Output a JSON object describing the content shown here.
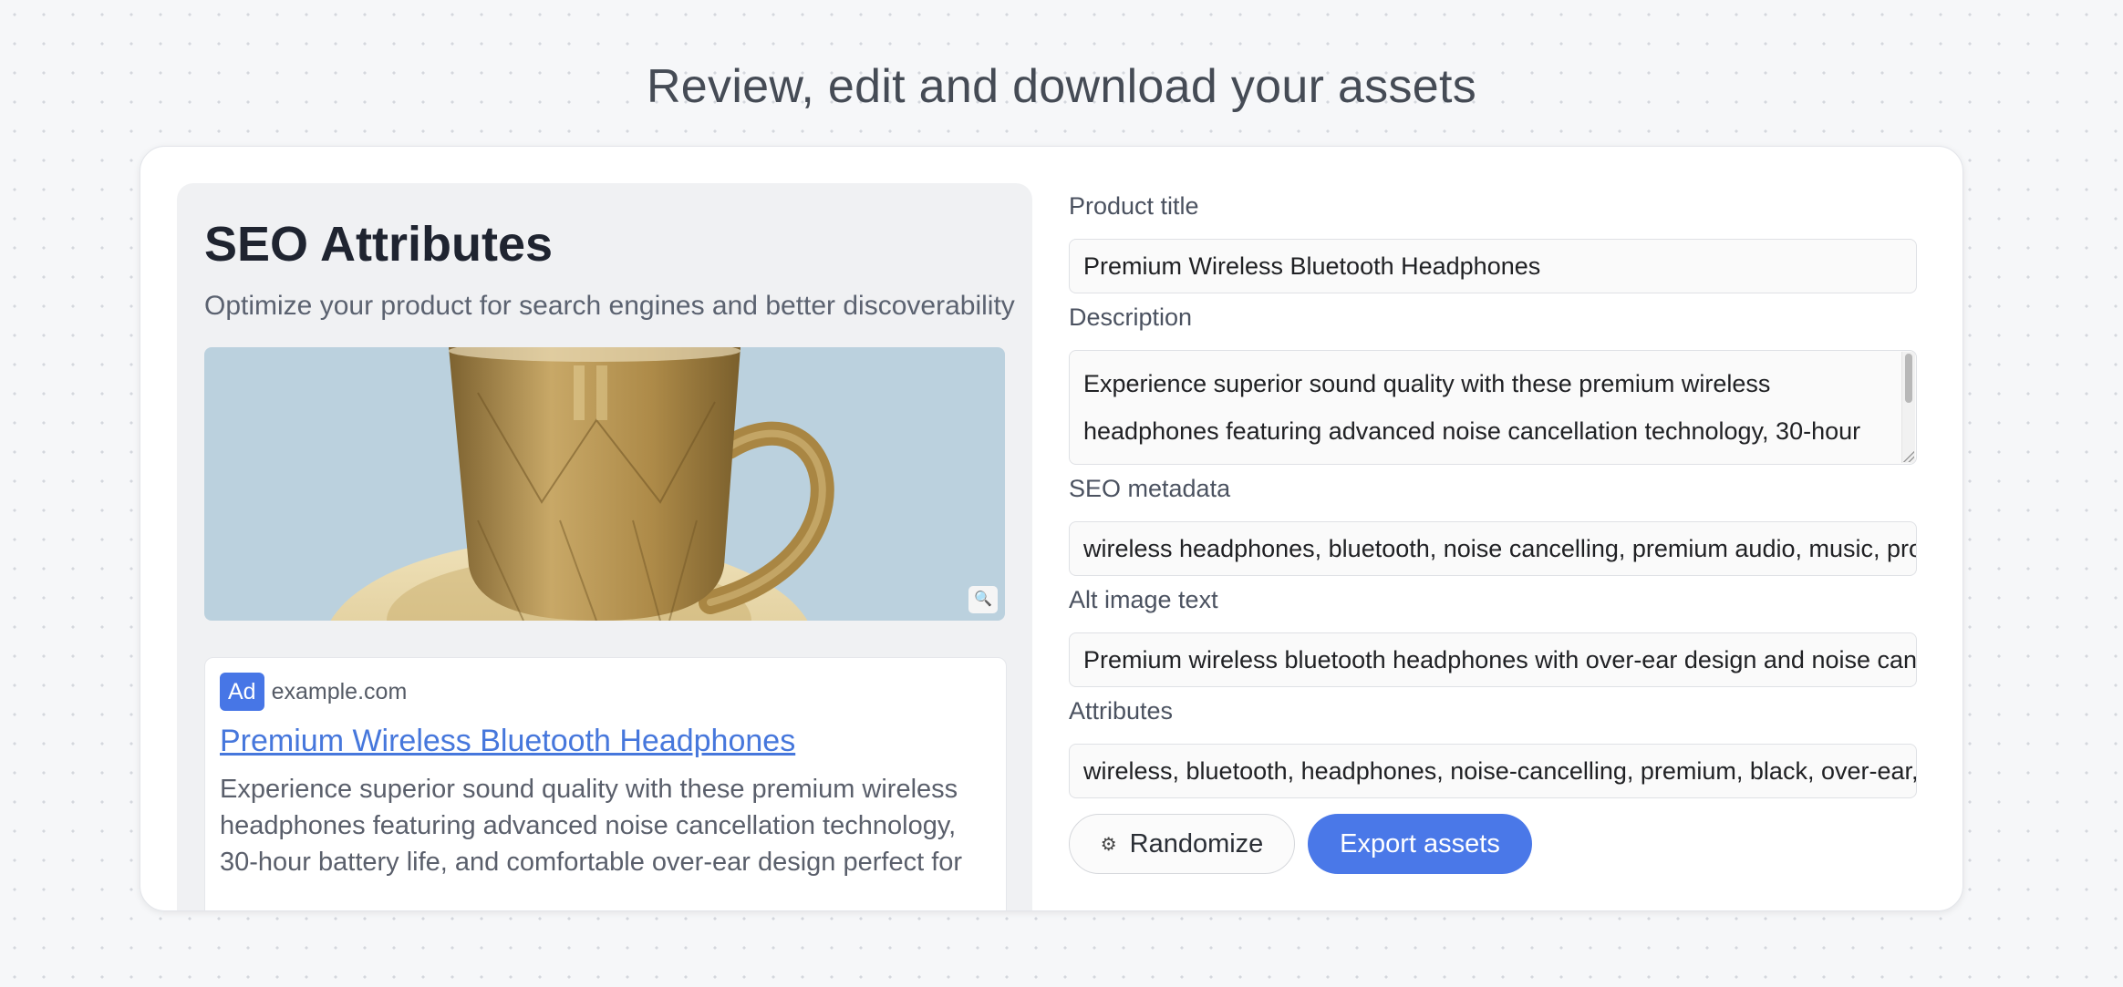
{
  "page": {
    "title": "Review, edit and download your assets"
  },
  "seo_panel": {
    "title": "SEO Attributes",
    "subtitle": "Optimize your product for search engines and better discoverability",
    "image_zoom_icon": "zoom-in-icon"
  },
  "ad_preview": {
    "badge": "Ad",
    "domain": "example.com",
    "title": "Premium Wireless Bluetooth Headphones",
    "description": "Experience superior sound quality with these premium wireless headphones featuring advanced noise cancellation technology, 30-hour battery life, and comfortable over-ear design perfect for"
  },
  "form": {
    "product_title": {
      "label": "Product title",
      "value": "Premium Wireless Bluetooth Headphones"
    },
    "description": {
      "label": "Description",
      "value": "Experience superior sound quality with these premium wireless headphones featuring advanced noise cancellation technology, 30-hour"
    },
    "seo_metadata": {
      "label": "SEO metadata",
      "value": "wireless headphones, bluetooth, noise cancelling, premium audio, music, prof"
    },
    "alt_image_text": {
      "label": "Alt image text",
      "value": "Premium wireless bluetooth headphones with over-ear design and noise canc"
    },
    "attributes": {
      "label": "Attributes",
      "value": "wireless, bluetooth, headphones, noise-cancelling, premium, black, over-ear, ;"
    }
  },
  "actions": {
    "randomize_label": "Randomize",
    "randomize_icon": "gear-icon",
    "export_label": "Export assets"
  },
  "colors": {
    "accent": "#4a78e8",
    "link": "#4677dc",
    "image_background": "#bbd1de"
  }
}
